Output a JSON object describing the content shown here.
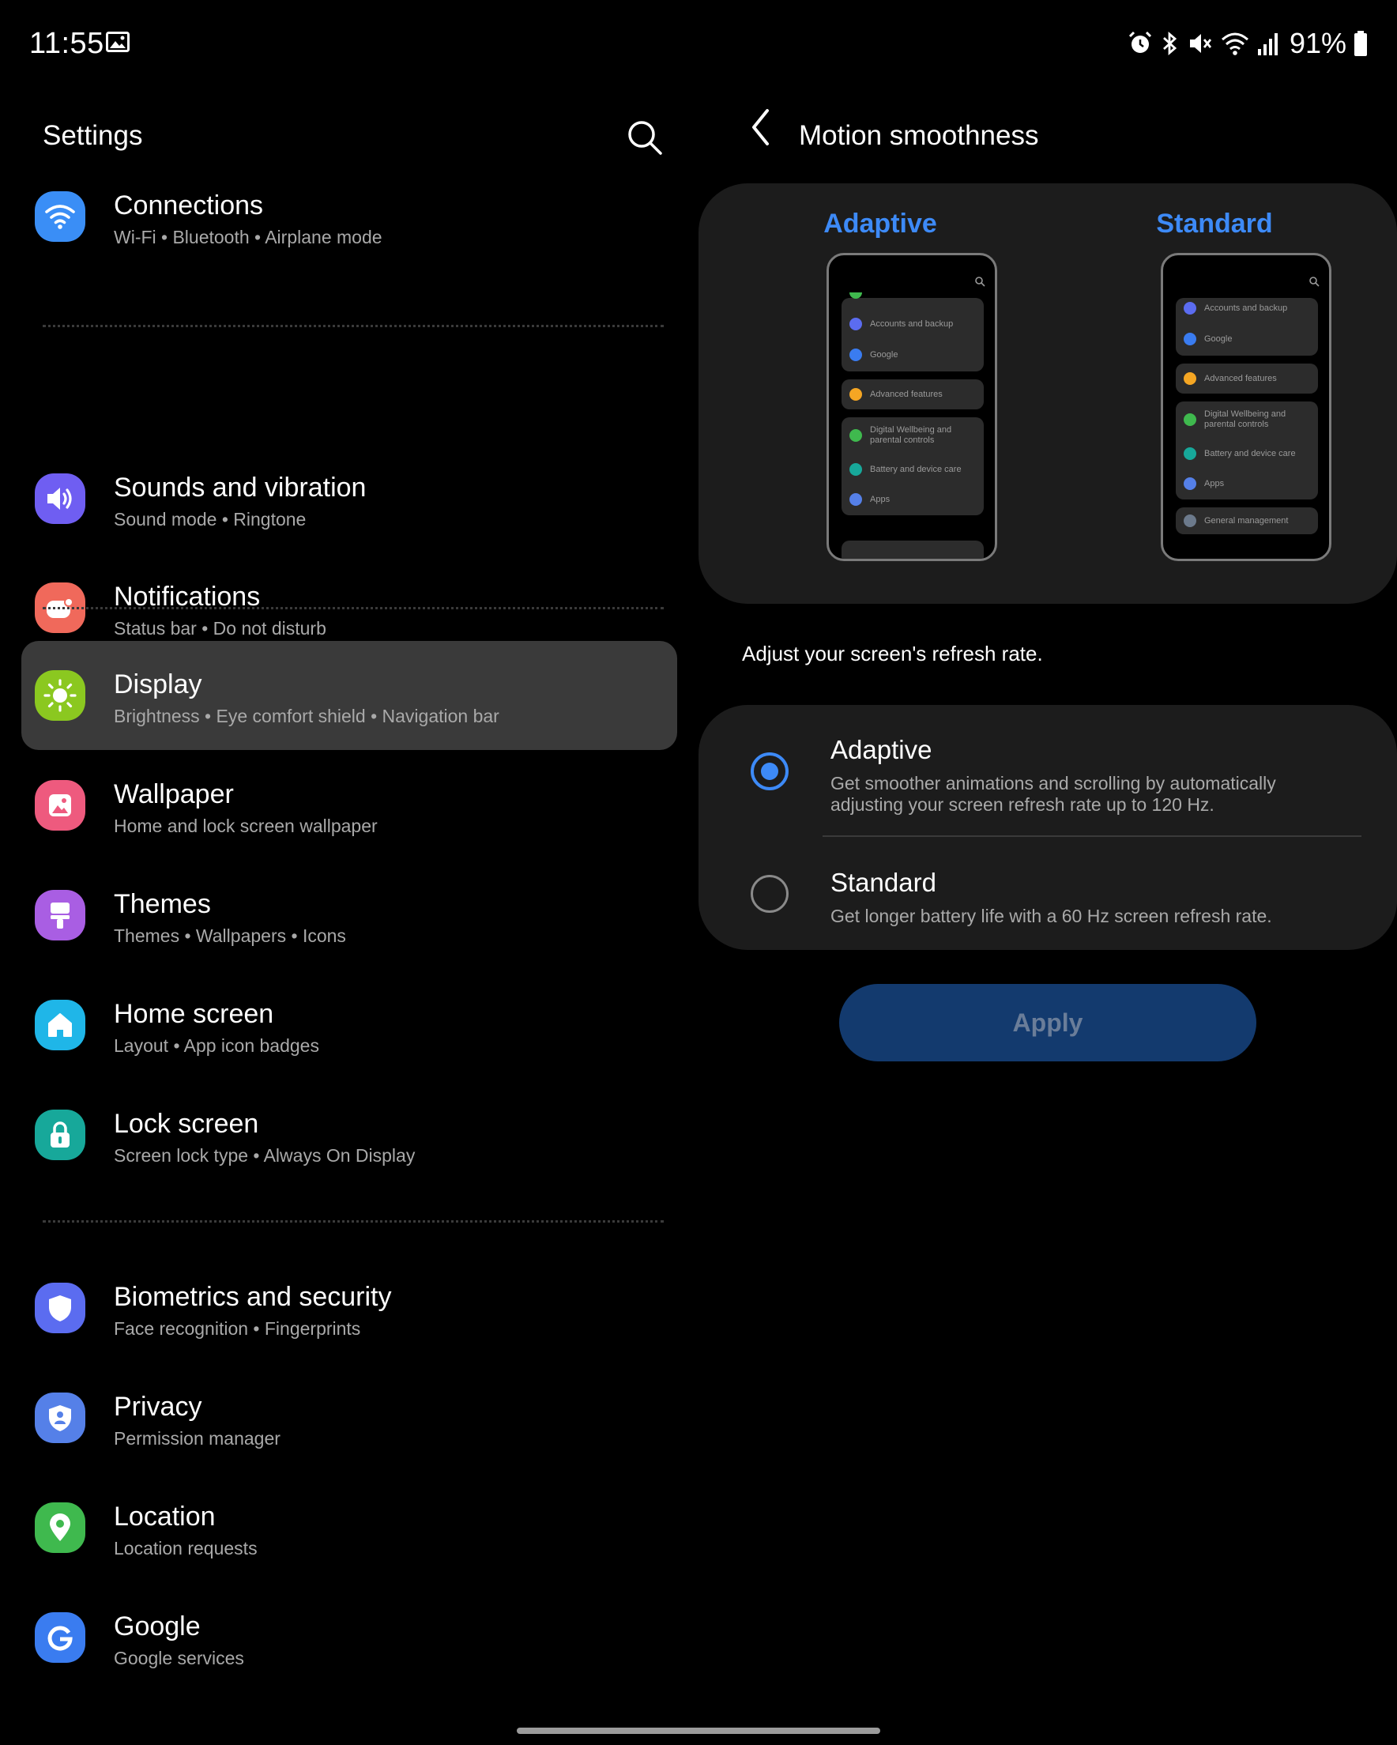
{
  "status_bar": {
    "time": "11:55",
    "battery": "91%",
    "icons": [
      "gallery-icon",
      "alarm-icon",
      "bluetooth-icon",
      "mute-icon",
      "wifi-icon",
      "signal-icon",
      "battery-icon"
    ]
  },
  "settings": {
    "title": "Settings",
    "items": [
      {
        "title": "Connections",
        "subtitle": "Wi-Fi  •  Bluetooth  •  Airplane mode",
        "icon": "wifi-icon",
        "color": "#3a8ef6"
      },
      {
        "title": "Sounds and vibration",
        "subtitle": "Sound mode  •  Ringtone",
        "icon": "speaker-icon",
        "color": "#6f5ef2"
      },
      {
        "title": "Notifications",
        "subtitle": "Status bar  •  Do not disturb",
        "icon": "notification-icon",
        "color": "#f0695b"
      },
      {
        "title": "Display",
        "subtitle": "Brightness  •  Eye comfort shield  •  Navigation bar",
        "icon": "sun-icon",
        "color": "#8bc820",
        "selected": true
      },
      {
        "title": "Wallpaper",
        "subtitle": "Home and lock screen wallpaper",
        "icon": "image-icon",
        "color": "#ee5a7e"
      },
      {
        "title": "Themes",
        "subtitle": "Themes  •  Wallpapers  •  Icons",
        "icon": "brush-icon",
        "color": "#a95ee3"
      },
      {
        "title": "Home screen",
        "subtitle": "Layout  •  App icon badges",
        "icon": "home-icon",
        "color": "#1fb6e8"
      },
      {
        "title": "Lock screen",
        "subtitle": "Screen lock type  •  Always On Display",
        "icon": "lock-icon",
        "color": "#17a89a"
      },
      {
        "title": "Biometrics and security",
        "subtitle": "Face recognition  •  Fingerprints",
        "icon": "shield-icon",
        "color": "#5b6cf0"
      },
      {
        "title": "Privacy",
        "subtitle": "Permission manager",
        "icon": "privacy-icon",
        "color": "#5580e8"
      },
      {
        "title": "Location",
        "subtitle": "Location requests",
        "icon": "location-icon",
        "color": "#3fb94e"
      },
      {
        "title": "Google",
        "subtitle": "Google services",
        "icon": "google-icon",
        "color": "#3a7cf0"
      }
    ]
  },
  "motion": {
    "title": "Motion smoothness",
    "preview": {
      "adaptive_label": "Adaptive",
      "standard_label": "Standard",
      "adaptive_rows": [
        "Accounts and backup",
        "Google",
        "Advanced features",
        "Digital Wellbeing and parental controls",
        "Battery and device care",
        "Apps"
      ],
      "standard_rows": [
        "Accounts and backup",
        "Google",
        "Advanced features",
        "Digital Wellbeing and parental controls",
        "Battery and device care",
        "Apps",
        "General management"
      ]
    },
    "description": "Adjust your screen's refresh rate.",
    "options": [
      {
        "title": "Adaptive",
        "description": "Get smoother animations and scrolling by automatically adjusting your screen refresh rate up to 120 Hz.",
        "selected": true
      },
      {
        "title": "Standard",
        "description": "Get longer battery life with a 60 Hz screen refresh rate.",
        "selected": false
      }
    ],
    "apply_label": "Apply"
  },
  "colors": {
    "accent": "#3d8af7",
    "selected_bg": "#3a3a3a",
    "card_bg": "#1c1c1c",
    "apply_bg": "#133a6e"
  }
}
